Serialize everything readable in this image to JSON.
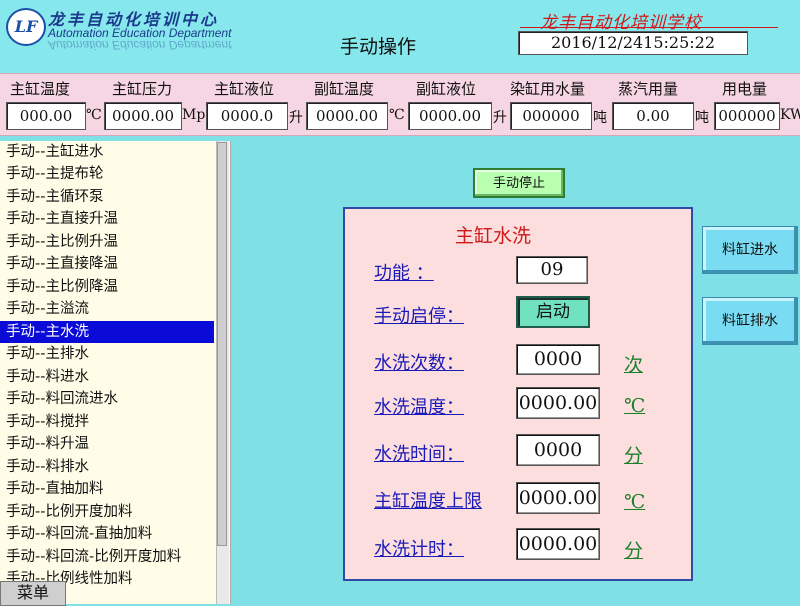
{
  "header": {
    "logo_badge": "LF",
    "logo_cn": "龙丰自动化培训中心",
    "logo_en": "Automation Education Department",
    "title": "手动操作",
    "school_name": "龙丰自动化培训学校",
    "datetime": "2016/12/2415:25:22"
  },
  "params": [
    {
      "label": "主缸温度",
      "value": "000.00",
      "unit": "℃"
    },
    {
      "label": "主缸压力",
      "value": "0000.00",
      "unit": "Mpa"
    },
    {
      "label": "主缸液位",
      "value": "0000.0",
      "unit": "升"
    },
    {
      "label": "副缸温度",
      "value": "0000.00",
      "unit": "℃"
    },
    {
      "label": "副缸液位",
      "value": "0000.00",
      "unit": "升"
    },
    {
      "label": "染缸用水量",
      "value": "000000",
      "unit": "吨"
    },
    {
      "label": "蒸汽用量",
      "value": "0.00",
      "unit": "吨"
    },
    {
      "label": "用电量",
      "value": "000000",
      "unit": "KW"
    }
  ],
  "side_list": {
    "selected_index": 8,
    "items": [
      "手动--主缸进水",
      "手动--主提布轮",
      "手动--主循环泵",
      "手动--主直接升温",
      "手动--主比例升温",
      "手动--主直接降温",
      "手动--主比例降温",
      "手动--主溢流",
      "手动--主水洗",
      "手动--主排水",
      "手动--料进水",
      "手动--料回流进水",
      "手动--料搅拌",
      "手动--料升温",
      "手动--料排水",
      "手动--直抽加料",
      "手动--比例开度加料",
      "手动--料回流-直抽加料",
      "手动--料回流-比例开度加料",
      "手动--比例线性加料"
    ]
  },
  "menu_label": "菜单",
  "stop_button_label": "手动停止",
  "panel": {
    "title": "主缸水洗",
    "function_label": "功能 ：",
    "function_value": "09",
    "start_stop_label": "手动启停：",
    "start_button": "启动",
    "rows": [
      {
        "label": "水洗次数：",
        "value": "0000",
        "unit": "次"
      },
      {
        "label": "水洗温度：",
        "value": "0000.00",
        "unit": "℃"
      },
      {
        "label": "水洗时间：",
        "value": "0000",
        "unit": "分"
      },
      {
        "label": "主缸温度上限",
        "value": "0000.00",
        "unit": "℃"
      },
      {
        "label": "水洗计时：",
        "value": "0000.00",
        "unit": "分"
      }
    ]
  },
  "side_buttons": {
    "feed_in": "料缸进水",
    "drain": "料缸排水"
  }
}
